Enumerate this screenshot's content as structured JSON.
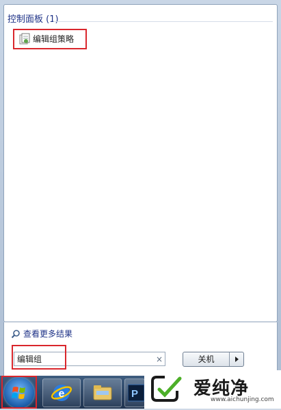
{
  "start_menu": {
    "section_title": "控制面板 (1)",
    "results": [
      {
        "label": "编辑组策略",
        "icon": "group-policy-icon"
      }
    ],
    "more_results_label": "查看更多结果",
    "search": {
      "value": "编辑组",
      "clear_icon": "×"
    },
    "shutdown_label": "关机"
  },
  "taskbar": {
    "start_button": "windows-orb-icon",
    "pinned": [
      "ie-icon",
      "explorer-icon",
      "photoshop-icon"
    ],
    "photoshop_letter": "P"
  },
  "watermark": {
    "title": "爱纯净",
    "url": "www.aichunjing.com"
  },
  "colors": {
    "highlight": "#d9262c",
    "section_title": "#1e3287",
    "accent_green": "#4caf28"
  }
}
